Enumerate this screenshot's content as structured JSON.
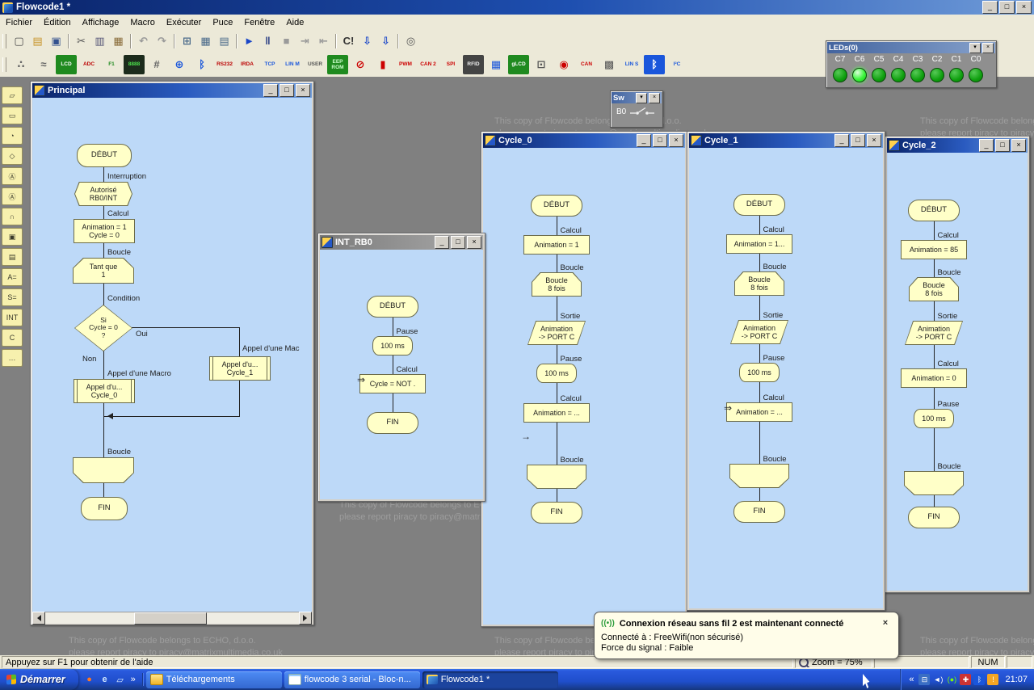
{
  "app": {
    "title": "Flowcode1 *",
    "window_buttons": [
      {
        "name": "minimize",
        "glyph": "_"
      },
      {
        "name": "maximize",
        "glyph": "□"
      },
      {
        "name": "close",
        "glyph": "×"
      }
    ],
    "panel_buttons": [
      {
        "name": "collapse",
        "glyph": "▾"
      },
      {
        "name": "close",
        "glyph": "×"
      }
    ]
  },
  "menubar": {
    "items": [
      "Fichier",
      "Édition",
      "Affichage",
      "Macro",
      "Exécuter",
      "Puce",
      "Fenêtre",
      "Aide"
    ]
  },
  "toolbar_main": {
    "items": [
      {
        "name": "new",
        "glyph": "▢",
        "color": "#4a4a4a"
      },
      {
        "name": "open",
        "glyph": "▤",
        "color": "#c8942a"
      },
      {
        "name": "save",
        "glyph": "▣",
        "color": "#33518e"
      },
      {
        "sep": true
      },
      {
        "name": "cut",
        "glyph": "✂",
        "color": "#555555"
      },
      {
        "name": "copy",
        "glyph": "▥",
        "color": "#555577"
      },
      {
        "name": "paste",
        "glyph": "▦",
        "color": "#8a6d3b"
      },
      {
        "sep": true
      },
      {
        "name": "undo",
        "glyph": "↶",
        "color": "#999999"
      },
      {
        "name": "redo",
        "glyph": "↷",
        "color": "#999999"
      },
      {
        "sep": true
      },
      {
        "name": "view-flowchart",
        "glyph": "⊞",
        "color": "#4a6a8a"
      },
      {
        "name": "view-panel",
        "glyph": "▦",
        "color": "#4a6a8a"
      },
      {
        "name": "view-code",
        "glyph": "▤",
        "color": "#4a6a8a"
      },
      {
        "sep": true
      },
      {
        "name": "run",
        "glyph": "►",
        "color": "#1a46c8"
      },
      {
        "name": "pause",
        "glyph": "‖",
        "color": "#2b3f85"
      },
      {
        "name": "stop",
        "glyph": "■",
        "color": "#9a9a9a"
      },
      {
        "name": "step-into",
        "glyph": "⇥",
        "color": "#9a9a9a"
      },
      {
        "name": "step-over",
        "glyph": "⇤",
        "color": "#9a9a9a"
      },
      {
        "sep": true
      },
      {
        "name": "compile",
        "glyph": "C!",
        "color": "#333333"
      },
      {
        "name": "compile-hex",
        "glyph": "⇩",
        "color": "#1a46c8"
      },
      {
        "name": "compile-chip",
        "glyph": "⇩",
        "color": "#1a46c8"
      },
      {
        "sep": true
      },
      {
        "name": "zoom",
        "glyph": "◎",
        "color": "#555555"
      }
    ]
  },
  "toolbar_components": {
    "items": [
      {
        "name": "connections",
        "glyph": "∴",
        "fg": "#666666",
        "big": true
      },
      {
        "name": "nets",
        "glyph": "≈",
        "fg": "#666666",
        "big": true
      },
      {
        "name": "lcd",
        "glyph": "LCD",
        "bg": "#1f8a1f",
        "fg": "#ffffff"
      },
      {
        "name": "adc",
        "glyph": "ADC",
        "fg": "#bb0000"
      },
      {
        "name": "f1",
        "glyph": "F1",
        "fg": "#1f8a1f"
      },
      {
        "name": "7seg",
        "glyph": "8888",
        "bg": "#1c2b1c",
        "fg": "#4ce04c"
      },
      {
        "name": "keypad",
        "glyph": "#",
        "fg": "#666666",
        "big": true
      },
      {
        "name": "internet",
        "glyph": "⊕",
        "fg": "#1a56db",
        "big": true
      },
      {
        "name": "bluetooth",
        "glyph": "ᛒ",
        "fg": "#1a56db",
        "big": true
      },
      {
        "name": "rs232",
        "glyph": "RS232",
        "fg": "#bb0000"
      },
      {
        "name": "irda",
        "glyph": "IRDA",
        "fg": "#bb0000"
      },
      {
        "name": "tcpip",
        "glyph": "TCP",
        "fg": "#1a56db"
      },
      {
        "name": "lin-master",
        "glyph": "LIN M",
        "fg": "#1a56db"
      },
      {
        "name": "user",
        "glyph": "USER",
        "fg": "#555555"
      },
      {
        "name": "eeprom",
        "glyph": "EEP\nROM",
        "bg": "#1f8a1f",
        "fg": "#ccffcc"
      },
      {
        "name": "disable",
        "glyph": "⊘",
        "fg": "#cc0000",
        "big": true
      },
      {
        "name": "thermometer",
        "glyph": "▮",
        "fg": "#cc0000",
        "big": true
      },
      {
        "name": "pwm",
        "glyph": "PWM",
        "fg": "#cc0000"
      },
      {
        "name": "can2",
        "glyph": "CAN 2",
        "fg": "#cc0000"
      },
      {
        "name": "spi",
        "glyph": "SPI",
        "fg": "#cc0000"
      },
      {
        "name": "rfid",
        "glyph": "RFID",
        "bg": "#444444",
        "fg": "#eeeeee"
      },
      {
        "name": "matrix",
        "glyph": "▦",
        "fg": "#1a56db",
        "big": true
      },
      {
        "name": "glcd",
        "glyph": "gLCD",
        "bg": "#1f8a1f",
        "fg": "#ffffff"
      },
      {
        "name": "panel",
        "glyph": "⊡",
        "fg": "#555555",
        "big": true
      },
      {
        "name": "speedo",
        "glyph": "◉",
        "fg": "#cc0000",
        "big": true
      },
      {
        "name": "can",
        "glyph": "CAN",
        "fg": "#cc0000"
      },
      {
        "name": "keypad2",
        "glyph": "▩",
        "fg": "#555555",
        "big": true
      },
      {
        "name": "lin-slave",
        "glyph": "LIN S",
        "fg": "#1a56db"
      },
      {
        "name": "bt-module",
        "glyph": "ᛒ",
        "bg": "#1a56db",
        "fg": "#ffffff",
        "big": true
      },
      {
        "name": "i2c",
        "glyph": "I²C",
        "fg": "#1a56db"
      }
    ]
  },
  "toolbox": {
    "items": [
      {
        "name": "input",
        "glyph": "▱"
      },
      {
        "name": "output",
        "glyph": "▭"
      },
      {
        "name": "delay",
        "glyph": "◔"
      },
      {
        "name": "decision",
        "glyph": "◇"
      },
      {
        "name": "connection",
        "glyph": "Ⓐ"
      },
      {
        "name": "goto-connection",
        "glyph": "Ⓐ"
      },
      {
        "name": "loop",
        "glyph": "∩"
      },
      {
        "name": "macro",
        "glyph": "▣"
      },
      {
        "name": "component-macro",
        "glyph": "▤"
      },
      {
        "name": "calculation",
        "glyph": "A="
      },
      {
        "name": "string-function",
        "glyph": "S="
      },
      {
        "name": "interrupt",
        "glyph": "INT"
      },
      {
        "name": "c-code",
        "glyph": "C"
      },
      {
        "name": "comment",
        "glyph": "…"
      }
    ]
  },
  "leds_panel": {
    "title": "LEDs(0)",
    "pins": [
      "C7",
      "C6",
      "C5",
      "C4",
      "C3",
      "C2",
      "C1",
      "C0"
    ],
    "lit_pin": "C6"
  },
  "watermark": {
    "line1": "This copy of Flowcode belongs to ECHO, d.o.o.",
    "line2": "please report piracy to piracy@matrixmultimedia.co.uk"
  },
  "windows": {
    "principal": {
      "title": "Principal",
      "nodes": {
        "start": {
          "text": "DÉBUT"
        },
        "interrupt": {
          "label": "Interruption",
          "text": "Autorisé\nRB0/INT"
        },
        "calc1": {
          "label": "Calcul",
          "text": "Animation = 1\nCycle = 0"
        },
        "loop_start": {
          "label": "Boucle",
          "text": "Tant que\n1"
        },
        "decision": {
          "label": "Condition",
          "text": "Si\nCycle = 0\n?",
          "yes_label": "Oui",
          "no_label": "Non"
        },
        "macro_cycle1": {
          "label": "Appel d'une Mac",
          "text": "Appel d'u...\nCycle_1"
        },
        "macro_cycle0": {
          "label": "Appel d'une Macro",
          "text": "Appel d'u...\nCycle_0"
        },
        "loop_end": {
          "label": "Boucle"
        },
        "end": {
          "text": "FIN"
        }
      }
    },
    "int_rb0": {
      "title": "INT_RB0",
      "flow": [
        {
          "type": "start",
          "text": "DÉBUT",
          "gap": 0
        },
        {
          "type": "pause",
          "label": "Pause",
          "text": "100 ms",
          "gap": 23
        },
        {
          "type": "calc",
          "label": "Calcul",
          "text": "Cycle = NOT .",
          "gap": 23,
          "marker": "⇒"
        },
        {
          "type": "end",
          "text": "FIN",
          "gap": 23
        }
      ]
    },
    "cycle_0": {
      "title": "Cycle_0",
      "flow": [
        {
          "type": "start",
          "text": "DÉBUT",
          "gap": 0
        },
        {
          "type": "calc",
          "label": "Calcul",
          "text": "Animation = 1",
          "gap": 23
        },
        {
          "type": "loop_start",
          "label": "Boucle",
          "text": "Boucle\n8 fois",
          "gap": 22
        },
        {
          "type": "output",
          "label": "Sortie",
          "text": "Animation\n-> PORT C",
          "gap": 30
        },
        {
          "type": "pause",
          "label": "Pause",
          "text": "100 ms",
          "gap": 23
        },
        {
          "type": "calc",
          "label": "Calcul",
          "text": "Animation = ...",
          "gap": 25
        },
        {
          "type": "loop_end",
          "label": "Boucle",
          "text": "",
          "gap": 52,
          "marker": "→",
          "marker_pos": "line"
        },
        {
          "type": "end",
          "text": "FIN",
          "gap": 16
        }
      ]
    },
    "cycle_1": {
      "title": "Cycle_1",
      "flow": [
        {
          "type": "start",
          "text": "DÉBUT",
          "gap": 0
        },
        {
          "type": "calc",
          "label": "Calcul",
          "text": "Animation = 1...",
          "gap": 23
        },
        {
          "type": "loop_start",
          "label": "Boucle",
          "text": "Boucle\n8 fois",
          "gap": 22
        },
        {
          "type": "output",
          "label": "Sortie",
          "text": "Animation\n-> PORT C",
          "gap": 30
        },
        {
          "type": "pause",
          "label": "Pause",
          "text": "100 ms",
          "gap": 23
        },
        {
          "type": "calc",
          "label": "Calcul",
          "text": "Animation = ...",
          "gap": 25,
          "marker": "⇒"
        },
        {
          "type": "loop_end",
          "label": "Boucle",
          "text": "",
          "gap": 52
        },
        {
          "type": "end",
          "text": "FIN",
          "gap": 16
        }
      ]
    },
    "cycle_2": {
      "title": "Cycle_2",
      "flow": [
        {
          "type": "start",
          "text": "DÉBUT",
          "gap": 0
        },
        {
          "type": "calc",
          "label": "Calcul",
          "text": "Animation = 85",
          "gap": 23
        },
        {
          "type": "loop_start",
          "label": "Boucle",
          "text": "Boucle\n8 fois",
          "gap": 22
        },
        {
          "type": "output",
          "label": "Sortie",
          "text": "Animation\n-> PORT C",
          "gap": 24
        },
        {
          "type": "calc",
          "label": "Calcul",
          "text": "Animation = 0",
          "gap": 29
        },
        {
          "type": "pause",
          "label": "Pause",
          "text": "100 ms",
          "gap": 26
        },
        {
          "type": "loop_end",
          "label": "Boucle",
          "text": "",
          "gap": 53
        },
        {
          "type": "end",
          "text": "FIN",
          "gap": 14
        }
      ]
    },
    "switch_panel": {
      "title": "Sw",
      "pin": "B0"
    }
  },
  "notification": {
    "icon_glyph": "((•))",
    "title": "Connexion réseau sans fil 2 est maintenant connecté",
    "close_glyph": "×",
    "line1": "Connecté à : FreeWifi(non sécurisé)",
    "line2": "Force du signal : Faible"
  },
  "statusbar": {
    "help": "Appuyez sur F1 pour obtenir de l'aide",
    "zoom": "Zoom = 75%",
    "num": "NUM"
  },
  "taskbar": {
    "start": "Démarrer",
    "quick_launch": [
      {
        "name": "launch-browser",
        "glyph": "●",
        "fg": "#ff7722"
      },
      {
        "name": "launch-internet-explorer",
        "glyph": "e",
        "fg": "#cfe6ff"
      },
      {
        "name": "launch-show-desktop",
        "glyph": "▱",
        "fg": "#ddeeff"
      }
    ],
    "quick_launch_chevron": "»",
    "tasks": [
      {
        "name": "telechargements",
        "label": "Téléchargements",
        "icon": "folder"
      },
      {
        "name": "bloc-notes",
        "label": "flowcode 3 serial - Bloc-n...",
        "icon": "notepad"
      },
      {
        "name": "flowcode",
        "label": "Flowcode1 *",
        "icon": "flowcode",
        "active": true
      }
    ],
    "tray_chevron": "«",
    "tray_icons": [
      {
        "name": "network-icon",
        "glyph": "⊟",
        "bg": "#3a6ec4",
        "fg": "#ffffff"
      },
      {
        "name": "volume-icon",
        "glyph": "◄)",
        "fg": "#ffffff"
      },
      {
        "name": "wireless-icon",
        "glyph": "(●)",
        "fg": "#7cfc00"
      },
      {
        "name": "security-icon",
        "glyph": "✚",
        "bg": "#cc3333",
        "fg": "#ffffff"
      },
      {
        "name": "bluetooth-icon",
        "glyph": "ᛒ",
        "bg": "#1a56db",
        "fg": "#ffffff"
      },
      {
        "name": "updates-icon",
        "glyph": "!",
        "bg": "#f5a623",
        "fg": "#ffffff"
      }
    ],
    "clock": "21:07"
  }
}
